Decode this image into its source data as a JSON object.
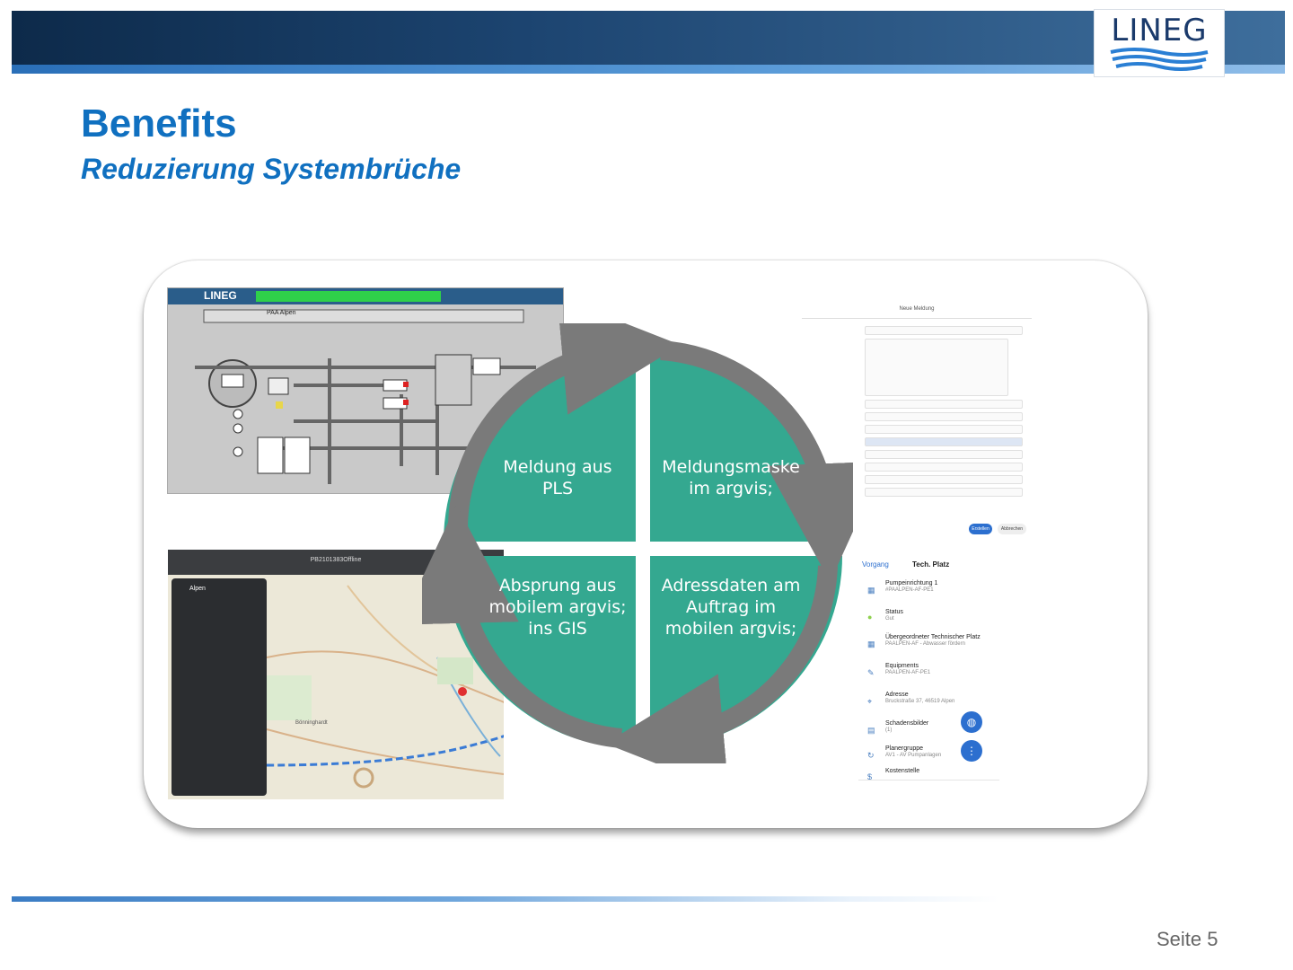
{
  "header": {
    "logo_text": "LINEG",
    "bar_color": "#1c4470",
    "accent_line_color": "#2a6fb8"
  },
  "slide": {
    "title": "Benefits",
    "subtitle": "Reduzierung Systembrüche",
    "title_color": "#1070c0"
  },
  "cycle": {
    "segment_color": "#34a890",
    "arrow_color": "#7a7a7a",
    "segments": [
      {
        "label_line1": "Meldung aus",
        "label_line2": "PLS"
      },
      {
        "label_line1": "Meldungsmaske",
        "label_line2": "im argvis;"
      },
      {
        "label_line1": "Adressdaten am",
        "label_line2": "Auftrag im",
        "label_line3": "mobilen argvis;"
      },
      {
        "label_line1": "Absprung aus",
        "label_line2": "mobilem argvis;",
        "label_line3": "ins GIS"
      }
    ]
  },
  "screenshots": {
    "scada": {
      "logo": "LINEG",
      "station": "PAA Alpen"
    },
    "form": {
      "title": "Neue Meldung",
      "buttons": [
        "Erstellen",
        "Abbrechen"
      ]
    },
    "map": {
      "sidebar_title": "Alpen",
      "place": "Bönninghardt"
    },
    "phone": {
      "back": "Vorgang",
      "title": "Tech. Platz",
      "items": [
        {
          "label": "Pumpeinrichtung 1",
          "value": "#PAALPEN-AF-PE1"
        },
        {
          "label": "Status",
          "value": "Gut"
        },
        {
          "label": "Übergeordneter Technischer Platz",
          "value": "PAALPEN-AF - Abwasser fördern"
        },
        {
          "label": "Equipments",
          "value": "PAALPEN-AF-PE1"
        },
        {
          "label": "Adresse",
          "value": "Bruckstraße 37, 46519 Alpen"
        },
        {
          "label": "Schadensbilder",
          "value": "(1)"
        },
        {
          "label": "Planergruppe",
          "value": "AV1 - AV Pumpanlagen"
        },
        {
          "label": "Kostenstelle",
          "value": ""
        }
      ]
    }
  },
  "footer": {
    "page_label": "Seite 5"
  }
}
